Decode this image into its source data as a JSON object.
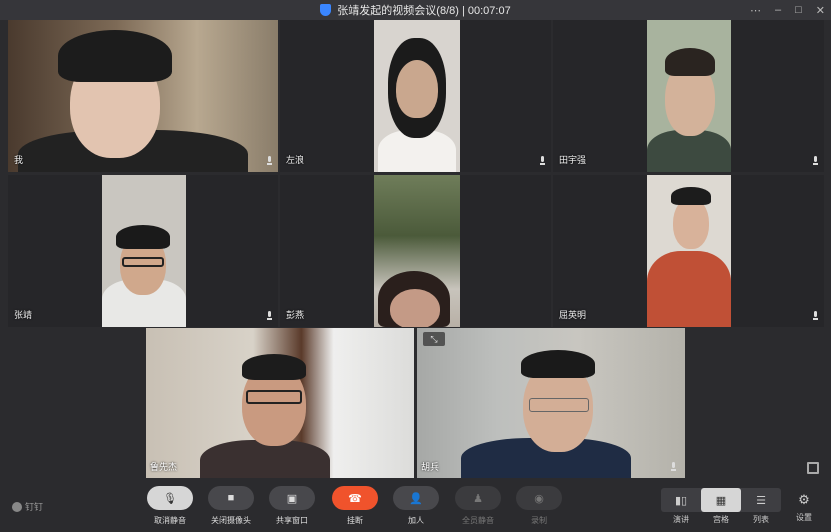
{
  "window": {
    "title": "张靖发起的视频会议(8/8) | 00:07:07",
    "controls": [
      "⋯",
      "–",
      "□",
      "✕"
    ]
  },
  "participants": [
    {
      "name": "我",
      "mic": true
    },
    {
      "name": "左浪",
      "mic": true
    },
    {
      "name": "田宇强",
      "mic": true
    },
    {
      "name": "张靖",
      "mic": true
    },
    {
      "name": "彭燕",
      "mic": false
    },
    {
      "name": "屈英明",
      "mic": true
    }
  ],
  "featured": [
    {
      "name": "鲁先杰",
      "mic": false
    },
    {
      "name": "胡兵",
      "mic": true
    }
  ],
  "brand": "钉钉",
  "toolbar": {
    "mute": "取消静音",
    "camera": "关闭摄像头",
    "share": "共享窗口",
    "hangup": "挂断",
    "add": "加人",
    "mute_all": "全员静音",
    "record": "录制"
  },
  "views": {
    "speaker": "演讲",
    "grid": "宫格",
    "list": "列表",
    "settings": "设置"
  },
  "colors": {
    "hangup": "#f0532c",
    "accent": "#3a86ff"
  }
}
